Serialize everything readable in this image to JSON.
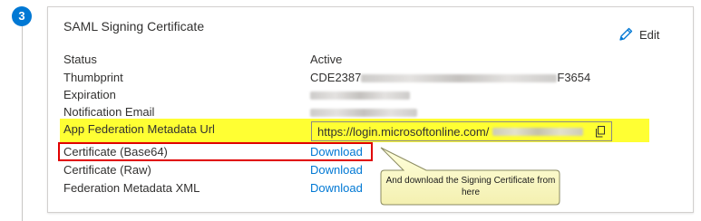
{
  "step": {
    "number": "3"
  },
  "section": {
    "title": "SAML Signing Certificate",
    "edit_label": "Edit"
  },
  "rows": {
    "status": {
      "label": "Status",
      "value": "Active"
    },
    "thumbprint": {
      "label": "Thumbprint",
      "value_prefix": "CDE2387",
      "value_suffix": "F3654"
    },
    "expiration": {
      "label": "Expiration"
    },
    "notification_email": {
      "label": "Notification Email"
    },
    "federation_metadata_url": {
      "label": "App Federation Metadata Url",
      "value": "https://login.microsoftonline.com/"
    },
    "cert_base64": {
      "label": "Certificate (Base64)",
      "link": "Download"
    },
    "cert_raw": {
      "label": "Certificate (Raw)",
      "link": "Download"
    },
    "federation_xml": {
      "label": "Federation Metadata XML",
      "link": "Download"
    }
  },
  "callout": {
    "text": "And download the Signing Certificate from here"
  },
  "colors": {
    "accent": "#0078d4",
    "highlight": "#ffff33",
    "annotation_red": "#e00000",
    "callout_fill": "#ffffcc"
  }
}
